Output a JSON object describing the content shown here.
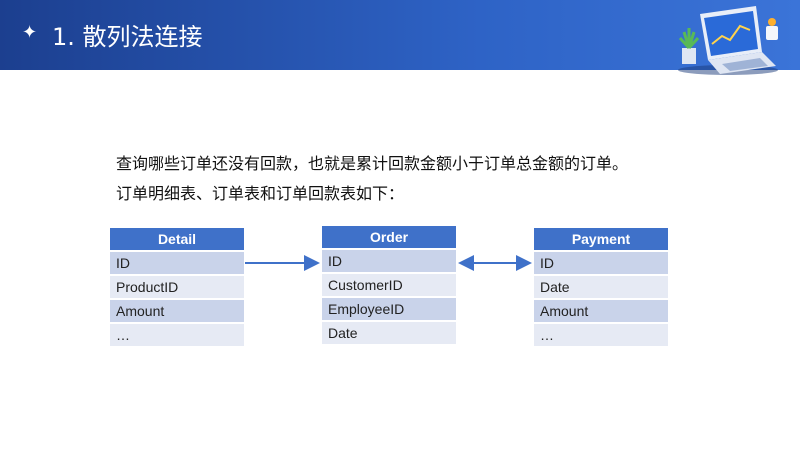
{
  "header": {
    "bullet_icon": "four-point-star-icon",
    "title": "1. 散列法连接",
    "illustration_icon": "laptop-with-plant-icon"
  },
  "body": {
    "line1": "查询哪些订单还没有回款，也就是累计回款金额小于订单总金额的订单。",
    "line2": "订单明细表、订单表和订单回款表如下："
  },
  "tables": {
    "detail": {
      "title": "Detail",
      "rows": [
        "ID",
        "ProductID",
        "Amount",
        "…"
      ]
    },
    "order": {
      "title": "Order",
      "rows": [
        "ID",
        "CustomerID",
        "EmployeeID",
        "Date"
      ]
    },
    "payment": {
      "title": "Payment",
      "rows": [
        "ID",
        "Date",
        "Amount",
        "…"
      ]
    }
  },
  "colors": {
    "header_bg": "#2e63c6",
    "table_header": "#3f71c9",
    "row_dark": "#c9d3ea",
    "row_light": "#e6eaf4",
    "arrow": "#3f71c9"
  }
}
